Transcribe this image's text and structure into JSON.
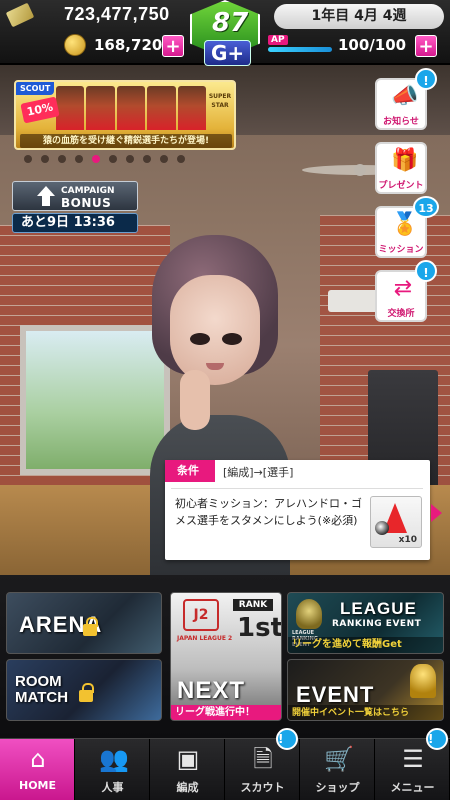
{
  "header": {
    "money": "723,477,750",
    "coins": "168,720",
    "date": "1年目 4月 4週",
    "ap_label": "AP",
    "ap_value": "100/100",
    "ap_fraction": 1.0,
    "badge_number": "87",
    "badge_grade": "G+",
    "plus_label": "+"
  },
  "scout_banner": {
    "tag": "SCOUT",
    "discount": "10%",
    "superstar": "SUPER STAR",
    "caption": "猿の血筋を受け継ぐ精鋭選手たちが登場!",
    "dot_count": 10,
    "active_dot": 4
  },
  "campaign": {
    "line1": "CAMPAIGN",
    "line2": "BONUS",
    "timer": "あと9日 13:36"
  },
  "side_buttons": [
    {
      "label": "お知らせ",
      "icon": "megaphone-icon",
      "badge": "!"
    },
    {
      "label": "プレゼント",
      "icon": "gift-icon",
      "badge": ""
    },
    {
      "label": "ミッション",
      "icon": "medal-icon",
      "badge": "13"
    },
    {
      "label": "交換所",
      "icon": "exchange-icon",
      "badge": "!"
    }
  ],
  "mission": {
    "cond_tag": "条件",
    "cond_path": "[編成]→[選手]",
    "description": "初心者ミッション：アレハンドロ・ゴメス選手をスタメンにしよう(※必須)",
    "reward_qty": "x10"
  },
  "panels": {
    "arena": "ARENA",
    "room_line1": "ROOM",
    "room_line2": "MATCH",
    "league_tag": "J2",
    "league_name": "JAPAN LEAGUE 2",
    "rank_label": "RANK",
    "rank_value": "1st",
    "next_title": "NEXT",
    "next_sub": "リーグ戦進行中！",
    "league_event_mini": "LEAGUE RANKING EVENT",
    "league_event_title": "LEAGUE",
    "league_event_title2": "RANKING EVENT",
    "league_event_sub": "リーグを進めて報酬Get",
    "event_title": "EVENT",
    "event_sub": "開催中イベント一覧はこちら"
  },
  "nav": [
    {
      "label": "HOME",
      "icon": "home-icon"
    },
    {
      "label": "人事",
      "icon": "people-icon"
    },
    {
      "label": "編成",
      "icon": "field-icon"
    },
    {
      "label": "スカウト",
      "icon": "scout-card-icon"
    },
    {
      "label": "ショップ",
      "icon": "cart-icon"
    },
    {
      "label": "メニュー",
      "icon": "menu-icon"
    }
  ],
  "nav_badges": {
    "scout": "!",
    "menu": "!"
  },
  "colors": {
    "accent": "#e8197e",
    "notify": "#1aa6ea",
    "badge_green": "#248a1c"
  }
}
